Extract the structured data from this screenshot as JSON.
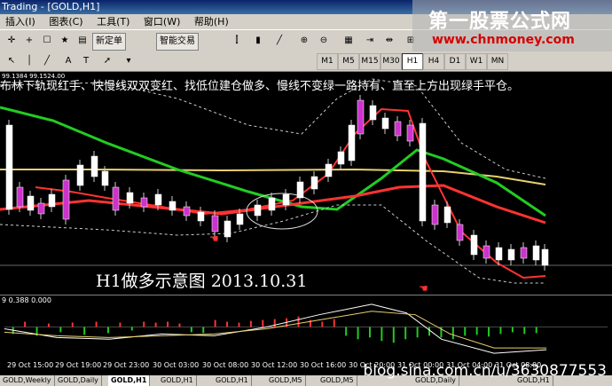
{
  "window": {
    "title": "Trading - [GOLD,H1]"
  },
  "menu": [
    "插入(I)",
    "图表(C)",
    "工具(T)",
    "窗口(W)",
    "帮助(H)"
  ],
  "toolbar": {
    "new_order": "新定单",
    "expert_advisors": "智能交易"
  },
  "timeframes": [
    "M1",
    "M5",
    "M15",
    "M30",
    "H1",
    "H4",
    "D1",
    "W1",
    "MN"
  ],
  "active_timeframe": "H1",
  "logo": {
    "title": "第一股票公式网",
    "url": "www.chnmoney.com"
  },
  "price_info": "99.1384 99.1524.00",
  "annotation": "布林下轨现红手、快慢线双双变红、找低位建仓做多、慢线不变绿一路持有、直至上方出现绿手平仓。",
  "caption": "H1做多示意图 2013.10.31",
  "sub_info": "9 0.388 0.000",
  "time_axis": [
    "29 Oct 15:00",
    "29 Oct 19:00",
    "29 Oct 23:00",
    "30 Oct 03:00",
    "30 Oct 08:00",
    "30 Oct 12:00",
    "30 Oct 16:00",
    "30 Oct 20:00",
    "31 Oct 00:00",
    "31 Oct 04:00",
    "31 Oct 08:00"
  ],
  "tabs": [
    "GOLD,Weekly",
    "GOLD,Daily",
    "GOLD,H1",
    "GOLD,H1",
    "GOLD,H1",
    "GOLD,M5",
    "GOLD,M5",
    "GOLD,Daily",
    "GOLD,H1"
  ],
  "active_tab_index": 2,
  "watermark": "blog.sina.com.cn/u/3630877553",
  "colors": {
    "up": "#ffffff",
    "down": "#cc33cc",
    "fast_ma": "#ff3333",
    "slow_ma": "#22cc22",
    "band": "#cccccc",
    "long_ma": "#e8d070"
  }
}
